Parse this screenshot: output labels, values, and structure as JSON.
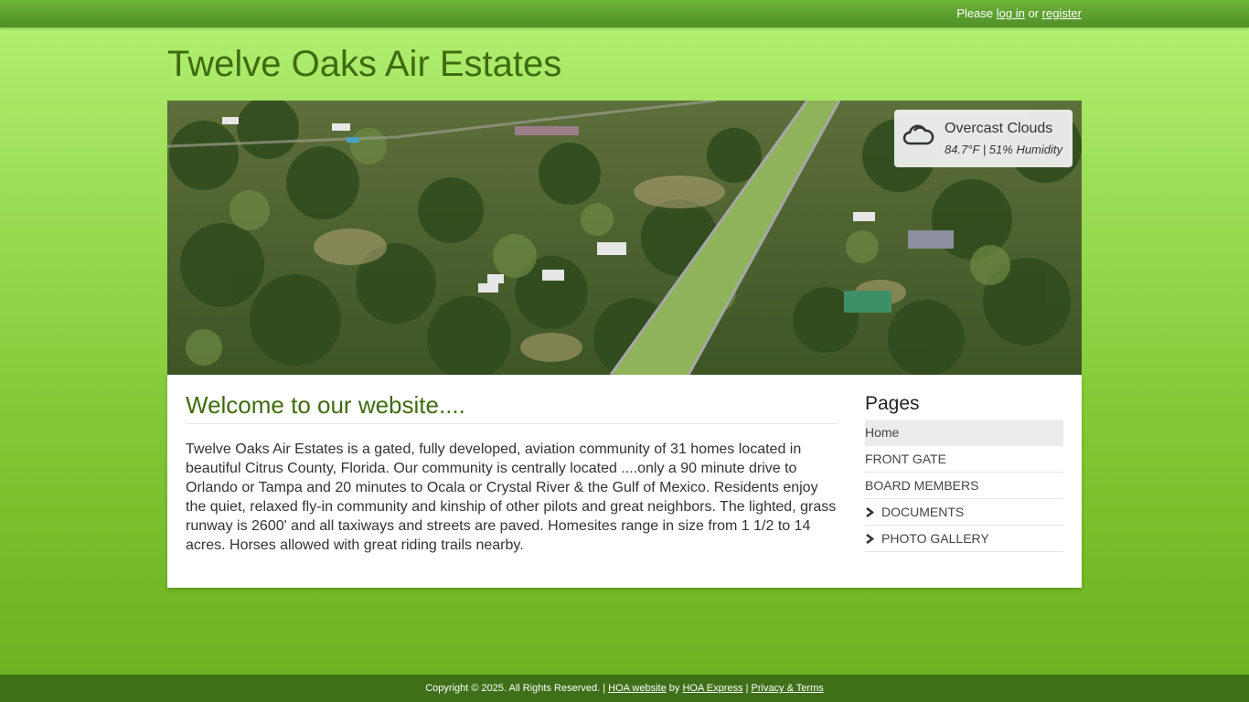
{
  "header": {
    "auth_prefix": "Please",
    "login_label": "log in",
    "or_text": "or",
    "register_label": "register"
  },
  "site_title": "Twelve Oaks Air Estates",
  "weather": {
    "icon": "cloud-icon",
    "condition": "Overcast Clouds",
    "detail": "84.7°F | 51% Humidity"
  },
  "main": {
    "heading": "Welcome to our website....",
    "body": "Twelve Oaks Air Estates is a gated, fully developed, aviation community of 31 homes located in beautiful Citrus County, Florida. Our community is centrally located ....only a 90 minute drive to Orlando or Tampa and 20 minutes to Ocala or Crystal River & the Gulf of Mexico.  Residents enjoy the quiet, relaxed fly-in community and kinship of other pilots and great neighbors. The lighted, grass runway is 2600' and all taxiways and streets are paved. Homesites range in size from 1 1/2 to 14 acres.  Horses allowed with great riding trails nearby."
  },
  "sidebar": {
    "title": "Pages",
    "items": [
      {
        "label": "Home"
      },
      {
        "label": "FRONT GATE"
      },
      {
        "label": "BOARD MEMBERS"
      },
      {
        "label": "DOCUMENTS"
      },
      {
        "label": "PHOTO GALLERY"
      }
    ]
  },
  "footer": {
    "copyright": "Copyright © 2025. All Rights Reserved. |",
    "hoa_website": "HOA website",
    "by": "by",
    "hoa_express": "HOA Express",
    "sep": "|",
    "privacy": "Privacy & Terms"
  },
  "colors": {
    "accent": "#3f6b10",
    "topbar": "#5a9a2c",
    "footer": "#3f7019"
  }
}
